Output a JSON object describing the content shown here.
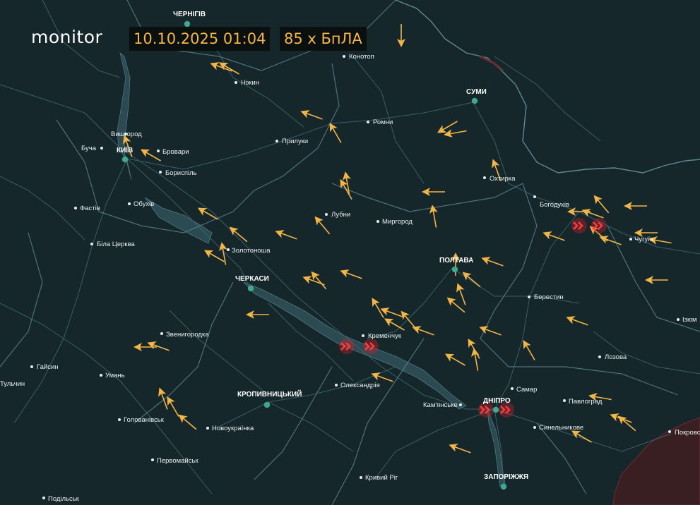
{
  "app": {
    "brand": "monitor"
  },
  "header": {
    "datetime": "10.10.2025 01:04",
    "drone_count": "85 x БпЛА"
  },
  "colors": {
    "background": "#15272a",
    "water": "#2c4a52",
    "borders": "#3f6872",
    "drone": "#f4b547",
    "explosion": "#e0202a",
    "occupied": "#3a1f22",
    "major_city_dot": "#3fa88e"
  },
  "cities": [
    {
      "name": "ЧЕРНІГІВ",
      "major": true
    },
    {
      "name": "Ніжин"
    },
    {
      "name": "Конотоп"
    },
    {
      "name": "СУМИ",
      "major": true
    },
    {
      "name": "Вишгород"
    },
    {
      "name": "Буча"
    },
    {
      "name": "КИЇВ",
      "major": true
    },
    {
      "name": "Бровари"
    },
    {
      "name": "Бориспіль"
    },
    {
      "name": "Прилуки"
    },
    {
      "name": "Ромни"
    },
    {
      "name": "Охтирка"
    },
    {
      "name": "Фастів"
    },
    {
      "name": "Обухів"
    },
    {
      "name": "Лубни"
    },
    {
      "name": "Миргород"
    },
    {
      "name": "Богодухів"
    },
    {
      "name": "Біла Церква"
    },
    {
      "name": "Золотоноша"
    },
    {
      "name": "ЧЕРКАСИ",
      "major": true
    },
    {
      "name": "ПОЛТАВА",
      "major": true
    },
    {
      "name": "Чугуїв"
    },
    {
      "name": "Берестин"
    },
    {
      "name": "Звенигородка"
    },
    {
      "name": "Кременчук"
    },
    {
      "name": "Ізюм"
    },
    {
      "name": "Гайсин"
    },
    {
      "name": "Лозова"
    },
    {
      "name": "Умань"
    },
    {
      "name": "Олександрія"
    },
    {
      "name": "Самар"
    },
    {
      "name": "Тульчин"
    },
    {
      "name": "КРОПИВНИЦЬКИЙ",
      "major": true
    },
    {
      "name": "Кам'янське"
    },
    {
      "name": "ДНІПРО",
      "major": true
    },
    {
      "name": "Павлоград"
    },
    {
      "name": "Голованівськ"
    },
    {
      "name": "Новоукраїнка"
    },
    {
      "name": "Синельникове"
    },
    {
      "name": "Покровськ"
    },
    {
      "name": "Первомайськ"
    },
    {
      "name": "ЗАПОРІЖЖЯ",
      "major": true
    },
    {
      "name": "Кривий Ріг"
    },
    {
      "name": "Подільськ"
    },
    {
      "name": "Умань"
    }
  ]
}
